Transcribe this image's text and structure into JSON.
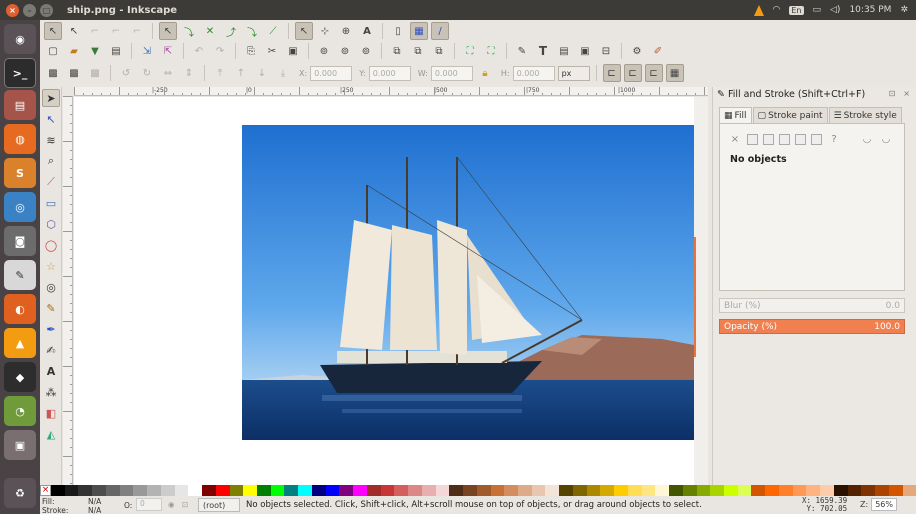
{
  "window": {
    "title": "ship.png - Inkscape"
  },
  "system_tray": {
    "keyboard_layout": "En",
    "clock": "10:35 PM"
  },
  "controls_bar": {
    "x_label": "X:",
    "x_value": "0.000",
    "y_label": "Y:",
    "y_value": "0.000",
    "w_label": "W:",
    "w_value": "0.000",
    "h_label": "H:",
    "h_value": "0.000",
    "unit": "px"
  },
  "ruler": {
    "top_labels": [
      "|-250",
      "|0",
      "|250",
      "|500",
      "|750",
      "|1000"
    ]
  },
  "dock": {
    "title": "Fill and Stroke (Shift+Ctrl+F)",
    "tabs": [
      {
        "label": "Fill",
        "active": true
      },
      {
        "label": "Stroke paint",
        "active": false
      },
      {
        "label": "Stroke style",
        "active": false
      }
    ],
    "no_objects_text": "No objects",
    "unset_glyph": "?",
    "blur_label": "Blur (%)",
    "blur_value": "0.0",
    "opacity_label": "Opacity (%)",
    "opacity_value": "100.0"
  },
  "status": {
    "fill_label": "Fill:",
    "fill_value": "N/A",
    "stroke_label": "Stroke:",
    "stroke_value": "N/A",
    "opacity_label": "O:",
    "opacity_value": "0",
    "layer": "(root)",
    "message": "No objects selected. Click, Shift+click, Alt+scroll mouse on top of objects, or drag around objects to select.",
    "cursor_x": "X: 1659.39",
    "cursor_y": "Y:  702.05",
    "zoom_label": "Z:",
    "zoom_value": "56%"
  },
  "colors": {
    "accent": "#e8743b",
    "panel_bg": "#3c3b37",
    "launcher_bg": "#4a4346"
  },
  "palette": [
    "#000000",
    "#1a1a1a",
    "#333333",
    "#4d4d4d",
    "#666666",
    "#808080",
    "#999999",
    "#b3b3b3",
    "#cccccc",
    "#e6e6e6",
    "#ffffff",
    "#800000",
    "#ff0000",
    "#808000",
    "#ffff00",
    "#008000",
    "#00ff00",
    "#008080",
    "#00ffff",
    "#000080",
    "#0000ff",
    "#800080",
    "#ff00ff",
    "#a02c2c",
    "#c83737",
    "#d35f5f",
    "#de8787",
    "#e9afaf",
    "#f4d7d7",
    "#502d16",
    "#784421",
    "#a05a2c",
    "#c87137",
    "#d38d5f",
    "#deaa87",
    "#e9c6af",
    "#f4e3d7",
    "#554400",
    "#806600",
    "#aa8800",
    "#d4aa00",
    "#ffcc00",
    "#ffdd55",
    "#ffe680",
    "#fff6d5",
    "#445500",
    "#668000",
    "#88aa00",
    "#aad400",
    "#ccff00",
    "#ddff55",
    "#d45500",
    "#ff6600",
    "#ff7f2a",
    "#ff9955",
    "#ffb380",
    "#ffccaa",
    "#2b1100",
    "#552200",
    "#803300",
    "#aa4400",
    "#d45500",
    "#e6a87a"
  ],
  "icons": {
    "launcher": [
      "ubuntu-dash-icon",
      "terminal-icon",
      "files-icon",
      "firefox-icon",
      "sublime-icon",
      "chromium-icon",
      "camera-icon",
      "text-editor-icon",
      "ubuntu-software-icon",
      "vlc-icon",
      "inkscape-icon",
      "image-viewer-icon",
      "workspace-icon",
      "trash-icon"
    ],
    "tools": [
      "select-icon",
      "node-icon",
      "tweak-icon",
      "zoom-icon",
      "measure-icon",
      "rect-icon",
      "box3d-icon",
      "ellipse-icon",
      "star-icon",
      "spiral-icon",
      "pencil-icon",
      "pen-icon",
      "calligraphy-icon",
      "text-icon",
      "spray-icon",
      "eraser-icon",
      "bucket-icon"
    ]
  }
}
